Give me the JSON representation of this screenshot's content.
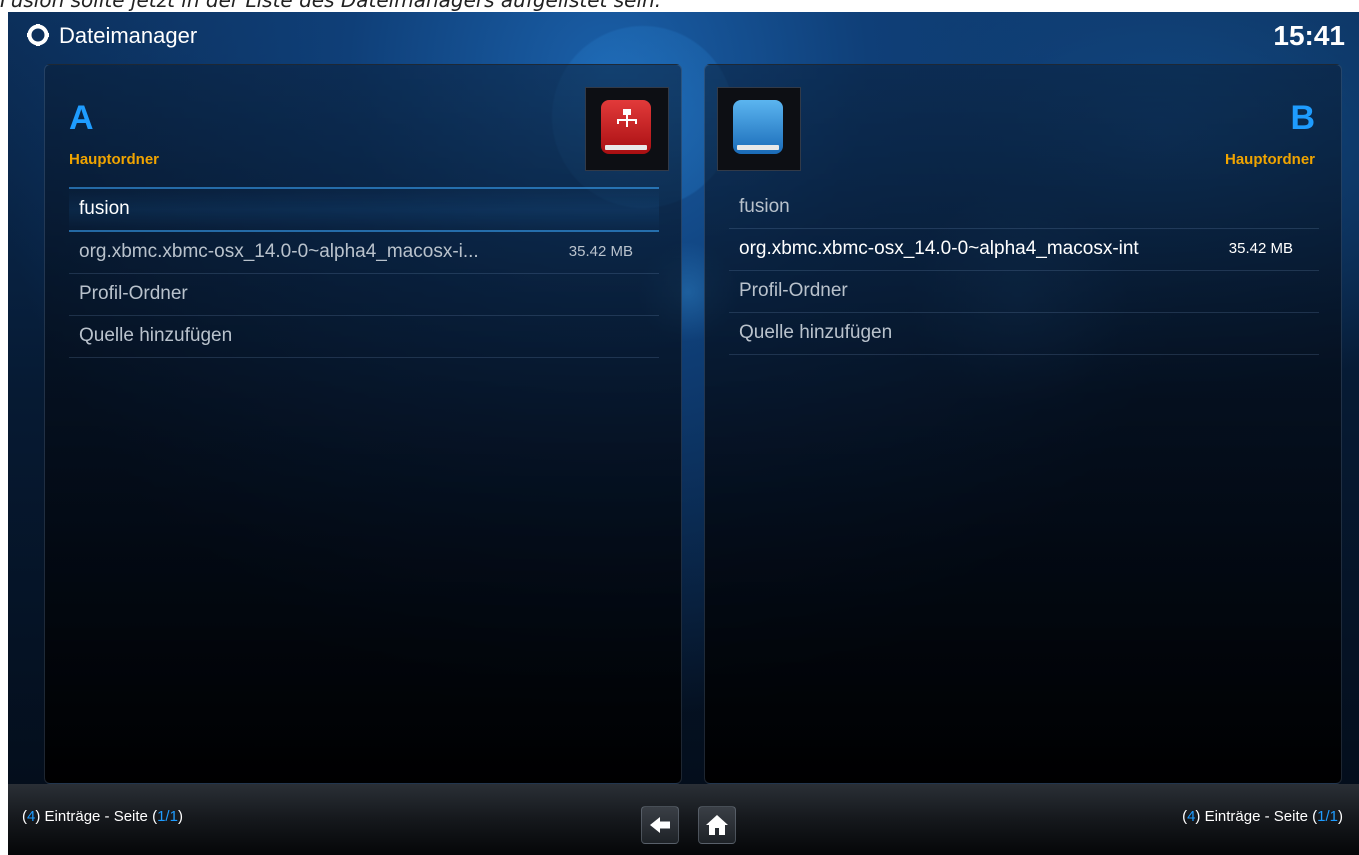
{
  "caption": "Fusion sollte jetzt in der Liste des Dateimanagers aufgelistet sein.",
  "header": {
    "title": "Dateimanager",
    "clock": "15:41"
  },
  "panels": [
    {
      "letter": "A",
      "folder_label": "Hauptordner",
      "drive_icon": "network-drive-icon",
      "items": [
        {
          "name": "fusion",
          "size": ""
        },
        {
          "name": "org.xbmc.xbmc-osx_14.0-0~alpha4_macosx-i...",
          "size": "35.42 MB"
        },
        {
          "name": "Profil-Ordner",
          "size": ""
        },
        {
          "name": "Quelle hinzufügen",
          "size": ""
        }
      ],
      "footer": {
        "count": "4",
        "label1": "Einträge - Seite (",
        "page": "1",
        "sep": "/",
        "total": "1",
        "close": ")"
      }
    },
    {
      "letter": "B",
      "folder_label": "Hauptordner",
      "drive_icon": "hard-drive-icon",
      "items": [
        {
          "name": "fusion",
          "size": ""
        },
        {
          "name": "org.xbmc.xbmc-osx_14.0-0~alpha4_macosx-int",
          "size": "35.42 MB"
        },
        {
          "name": "Profil-Ordner",
          "size": ""
        },
        {
          "name": "Quelle hinzufügen",
          "size": ""
        }
      ],
      "footer": {
        "count": "4",
        "label1": "Einträge - Seite (",
        "page": "1",
        "sep": "/",
        "total": "1",
        "close": ")"
      }
    }
  ],
  "nav": {
    "back_icon": "back-arrow-icon",
    "home_icon": "home-icon"
  },
  "colors": {
    "accent": "#1e9cff",
    "folder_label": "#f0a400"
  }
}
